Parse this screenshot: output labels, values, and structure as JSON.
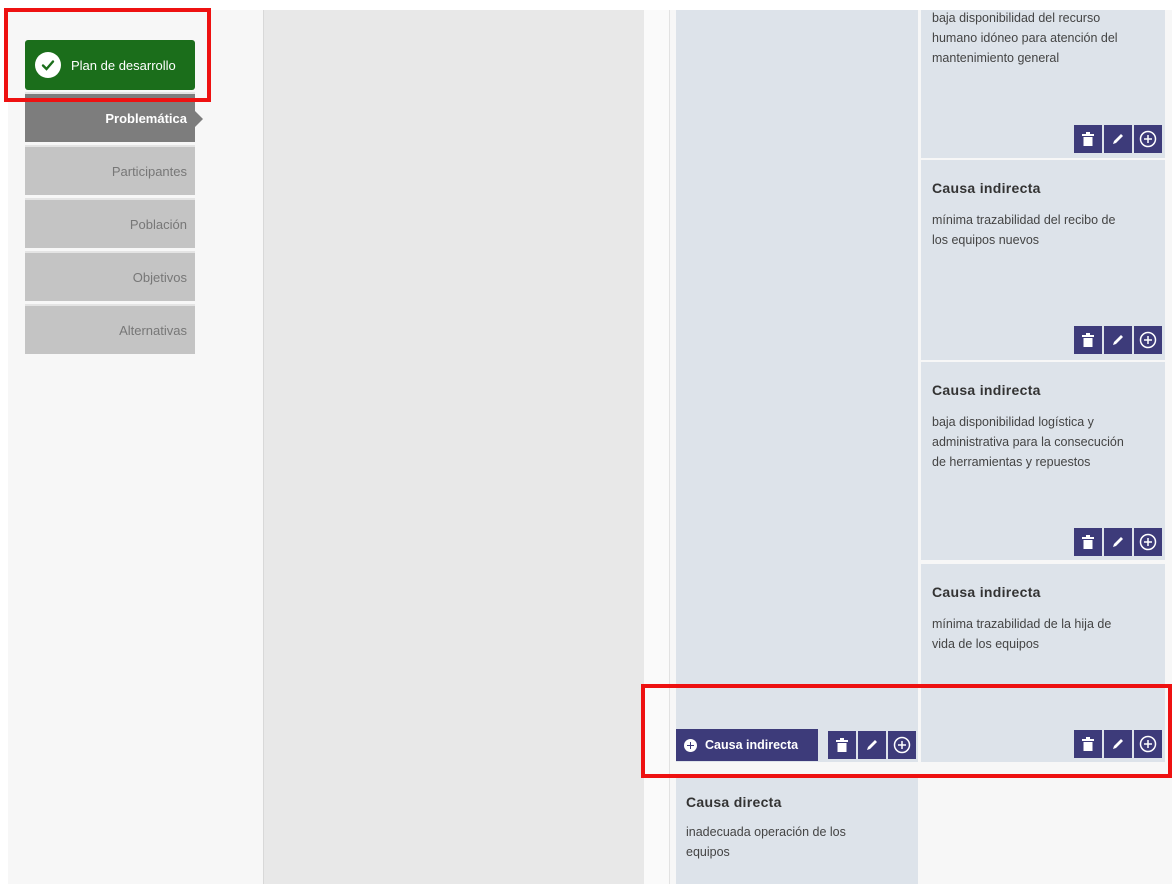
{
  "nav": {
    "active_label": "Plan de desarrollo",
    "items": [
      {
        "label": "Problemática",
        "current": true
      },
      {
        "label": "Participantes"
      },
      {
        "label": "Población"
      },
      {
        "label": "Objetivos"
      },
      {
        "label": "Alternativas"
      }
    ]
  },
  "cards": [
    {
      "title": "",
      "text": "baja disponibilidad del recurso humano idóneo para atención del mantenimiento general"
    },
    {
      "title": "Causa indirecta",
      "text": "mínima trazabilidad del recibo de los equipos nuevos"
    },
    {
      "title": "Causa indirecta",
      "text": "baja disponibilidad logística y administrativa para la consecución de herramientas y repuestos"
    },
    {
      "title": "Causa indirecta",
      "text": "mínima trazabilidad de la hija de vida de los equipos"
    }
  ],
  "add_indirect_label": "Causa indirecta",
  "direct": {
    "title": "Causa directa",
    "text": "inadecuada operación de los equipos"
  },
  "icons": {
    "delete": "trash-icon",
    "edit": "pencil-icon",
    "add": "plus-circle-icon"
  },
  "colors": {
    "active": "#1b6e1b",
    "button": "#3d3b7a",
    "card": "#dde3ea",
    "highlight": "#ee1111"
  }
}
